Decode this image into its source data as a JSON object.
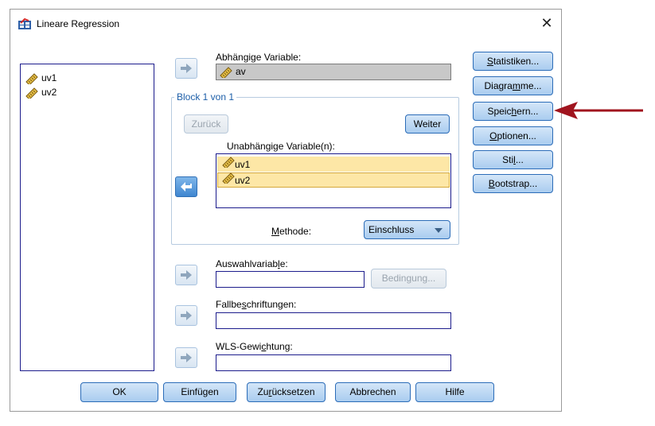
{
  "window": {
    "title": "Lineare Regression",
    "close_glyph": "✕"
  },
  "source_list": {
    "items": [
      {
        "name": "uv1"
      },
      {
        "name": "uv2"
      }
    ]
  },
  "dependent": {
    "label": "Abhängige Variable:",
    "value": "av"
  },
  "block": {
    "legend": "Block 1 von 1",
    "back_label": "Zurück",
    "next_label": "Weiter",
    "independent_label": "Unabhängige Variable(n):",
    "independent_items": [
      {
        "name": "uv1"
      },
      {
        "name": "uv2"
      }
    ],
    "method_label_pre": "M",
    "method_label_rest": "ethode:",
    "method_value": "Einschluss"
  },
  "selection": {
    "label_pre": "Auswahlvariab",
    "label_u": "l",
    "label_post": "e:",
    "value": "",
    "condition_pre": "Bedin",
    "condition_u": "g",
    "condition_post": "ung..."
  },
  "case_labels": {
    "label_pre": "Fallbe",
    "label_u": "s",
    "label_post": "chriftungen:",
    "value": ""
  },
  "wls": {
    "label_pre": "WLS-Gewi",
    "label_u": "c",
    "label_post": "htung:",
    "value": ""
  },
  "side_buttons": [
    {
      "name": "statistiken-button",
      "u": "S",
      "rest": "tatistiken...",
      "pre": ""
    },
    {
      "name": "diagramme-button",
      "pre": "Diagra",
      "u": "m",
      "rest": "me..."
    },
    {
      "name": "speichern-button",
      "pre": "Speic",
      "u": "h",
      "rest": "ern..."
    },
    {
      "name": "optionen-button",
      "pre": "",
      "u": "O",
      "rest": "ptionen..."
    },
    {
      "name": "stil-button",
      "pre": "Sti",
      "u": "l",
      "rest": "..."
    },
    {
      "name": "bootstrap-button",
      "pre": "",
      "u": "B",
      "rest": "ootstrap..."
    }
  ],
  "bottom_buttons": {
    "ok": "OK",
    "paste": "Einfügen",
    "reset_pre": "Zu",
    "reset_u": "r",
    "reset_post": "ücksetzen",
    "cancel": "Abbrechen",
    "help": "Hilfe"
  },
  "colors": {
    "annotation_arrow": "#a0141e",
    "button_border": "#2b6cb8"
  }
}
